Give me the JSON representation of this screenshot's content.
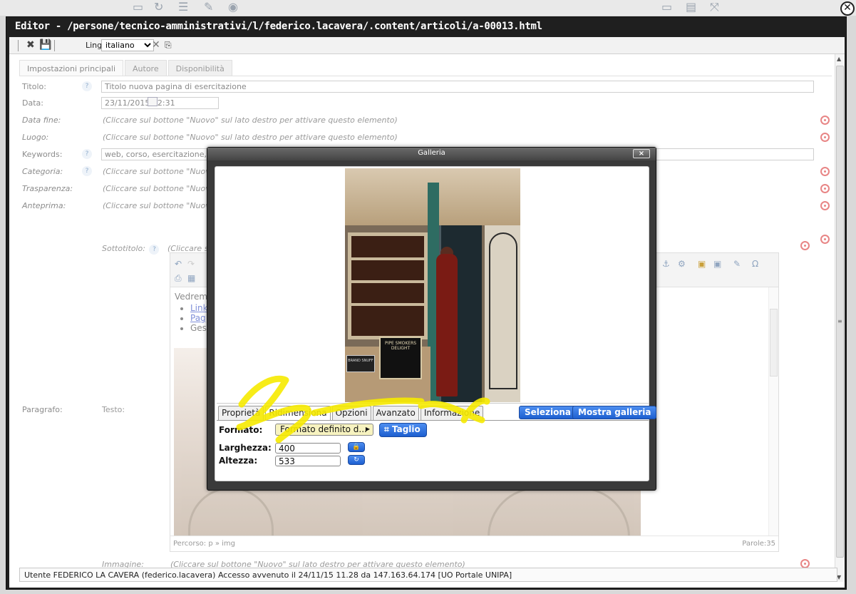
{
  "editor": {
    "title": "Editor - /persone/tecnico-amministrativi/l/federico.lacavera/.content/articoli/a-00013.html",
    "toolbar": {
      "language_label": "Lingua",
      "language_value": "italiano",
      "icons": [
        "delete-save-icon",
        "save-icon",
        "close-x-icon",
        "copy-icon"
      ]
    },
    "tabs": [
      "Impostazioni principali",
      "Autore",
      "Disponibilità"
    ],
    "fields": {
      "titolo": {
        "label": "Titolo:",
        "value": "Titolo nuova pagina di esercitazione"
      },
      "data": {
        "label": "Data:",
        "value": "23/11/2015 12:31"
      },
      "data_fine": {
        "label": "Data fine:",
        "hint": "(Cliccare sul bottone \"Nuovo\" sul lato destro per attivare questo elemento)"
      },
      "luogo": {
        "label": "Luogo:",
        "hint": "(Cliccare sul bottone \"Nuovo\" sul lato destro per attivare questo elemento)"
      },
      "keywords": {
        "label": "Keywords:",
        "value": "web, corso, esercitazione,"
      },
      "categoria": {
        "label": "Categoria:",
        "hint": "(Cliccare sul bottone \"Nuovo\" s"
      },
      "trasparenza": {
        "label": "Trasparenza:",
        "hint": "(Cliccare sul bottone \"Nuovo\" s"
      },
      "anteprima": {
        "label": "Anteprima:",
        "hint": "(Cliccare sul bottone \"Nuovo\" s"
      },
      "sottotitolo": {
        "label": "Sottotitolo:",
        "hint": "(Cliccare sul"
      },
      "paragrafo": {
        "label": "Paragrafo:"
      },
      "testo": {
        "label": "Testo:"
      },
      "immagine": {
        "label": "Immagine:",
        "hint": "(Cliccare sul bottone \"Nuovo\" sul lato destro per attivare questo elemento)"
      }
    },
    "rte": {
      "content_start": "Vedremo",
      "list": [
        "Link",
        "Pag",
        "Ges"
      ],
      "path": "Percorso: p » img",
      "words": "Parole:35"
    },
    "status": "Utente FEDERICO LA CAVERA (federico.lacavera) Accesso avvenuto il 24/11/15 11.28 da 147.163.64.174 [UO Portale UNIPA]"
  },
  "gallery": {
    "title": "Galleria",
    "close_label": "×",
    "tabs": [
      "Proprietà",
      "Ridimensiona",
      "Opzioni",
      "Avanzato",
      "Informazione"
    ],
    "active_tab": "Ridimensiona",
    "buttons": {
      "select": "Seleziona",
      "show": "Mostra galleria",
      "crop": "Taglio"
    },
    "form": {
      "format_label": "Formato:",
      "format_value": "Formato definito d...",
      "width_label": "Larghezza:",
      "width_value": "400",
      "height_label": "Altezza:",
      "height_value": "533"
    },
    "image_text": {
      "sign": "PIPE SMOKERS DELIGHT",
      "banner": "BRAND SNUFF"
    },
    "highlight_color": "#f6ea00"
  }
}
